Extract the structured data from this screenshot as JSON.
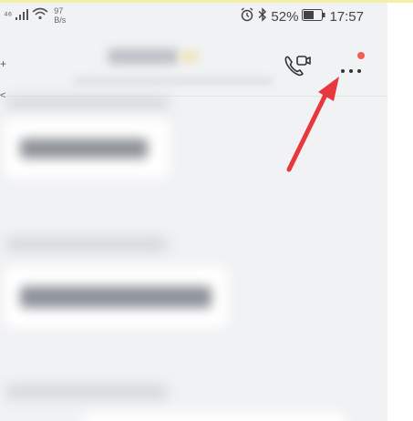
{
  "status_bar": {
    "signal_label": "⁴⁶",
    "net_speed_value": "97",
    "net_speed_unit": "B/s",
    "battery_percent": "52%",
    "time": "17:57"
  },
  "header": {
    "left_edge_top": "+",
    "left_edge_bottom": "<"
  },
  "colors": {
    "background": "#f1f2f4",
    "notification_dot": "#f0624f",
    "annotation_arrow": "#e8383d"
  },
  "icons": {
    "call": "video-call-icon",
    "more": "more-options-icon",
    "alarm": "alarm-icon",
    "bluetooth": "bluetooth-icon",
    "battery": "battery-icon",
    "wifi": "wifi-icon",
    "signal": "signal-icon"
  }
}
